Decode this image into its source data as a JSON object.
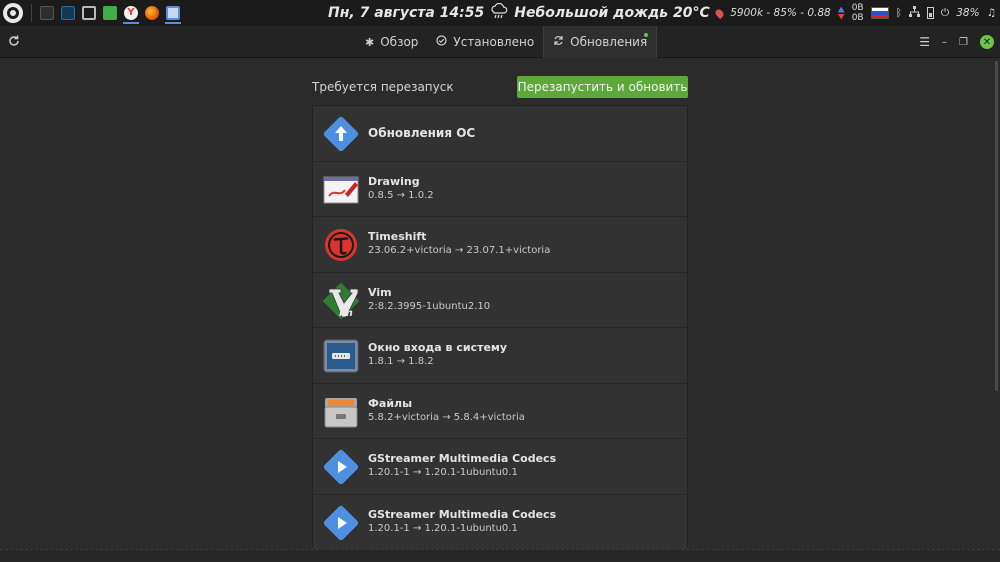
{
  "system_panel": {
    "clock": "Пн, 7 августа 14:55",
    "weather": "Небольшой дождь 20°C",
    "weather_icon": "rain-cloud-icon",
    "stats": "5900k - 85% - 0.88",
    "net_up": "0B",
    "net_down": "0B",
    "battery": "38%",
    "keyboard_layout_flag": "ru-flag-icon",
    "tasks": [
      {
        "name": "terminal",
        "color": "#2e2e2e"
      },
      {
        "name": "system-monitor",
        "color": "#1f4e6e"
      },
      {
        "name": "screenshot",
        "color": "#8a8a8a"
      },
      {
        "name": "files",
        "color": "#3fae49"
      },
      {
        "name": "yandex-browser",
        "color": "#e33b2e"
      },
      {
        "name": "firefox",
        "color": "#e66000"
      },
      {
        "name": "software-manager",
        "color": "#5a8fd6"
      }
    ]
  },
  "header": {
    "tabs": [
      {
        "label": "Обзор",
        "icon": "asterisk-icon"
      },
      {
        "label": "Установлено",
        "icon": "check-circle-icon"
      },
      {
        "label": "Обновления",
        "icon": "refresh-icon"
      }
    ]
  },
  "content": {
    "restart_label": "Требуется перезапуск",
    "restart_button": "Перезапустить и обновить",
    "updates": [
      {
        "title": "Обновления ОС",
        "version": "",
        "icon": "os-update-icon"
      },
      {
        "title": "Drawing",
        "version": "0.8.5 → 1.0.2",
        "icon": "drawing-icon"
      },
      {
        "title": "Timeshift",
        "version": "23.06.2+victoria → 23.07.1+victoria",
        "icon": "timeshift-icon"
      },
      {
        "title": "Vim",
        "version": "2:8.2.3995-1ubuntu2.10",
        "icon": "vim-icon"
      },
      {
        "title": "Окно входа в систему",
        "version": "1.8.1 → 1.8.2",
        "icon": "login-window-icon"
      },
      {
        "title": "Файлы",
        "version": "5.8.2+victoria → 5.8.4+victoria",
        "icon": "files-icon"
      },
      {
        "title": "GStreamer Multimedia Codecs",
        "version": "1.20.1-1 → 1.20.1-1ubuntu0.1",
        "icon": "gstreamer-icon"
      },
      {
        "title": "GStreamer Multimedia Codecs",
        "version": "1.20.1-1 → 1.20.1-1ubuntu0.1",
        "icon": "gstreamer-icon"
      }
    ]
  }
}
